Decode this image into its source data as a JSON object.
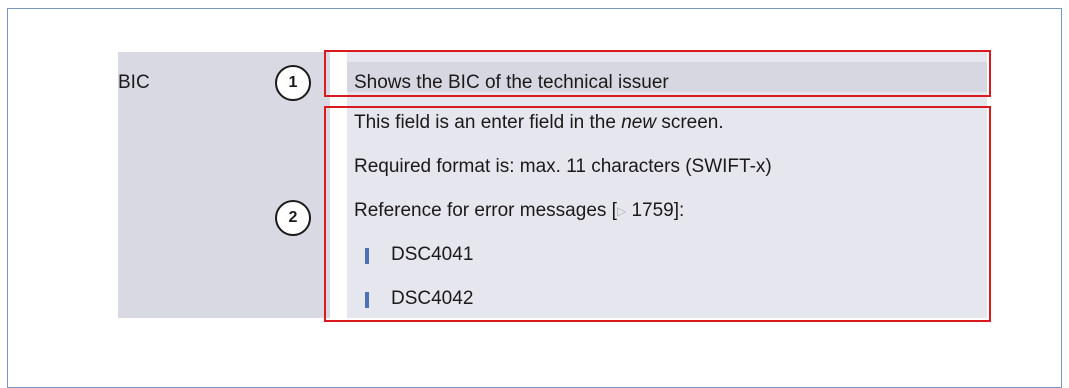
{
  "field": {
    "label": "BIC"
  },
  "description": {
    "summary": "Shows the BIC of the technical issuer",
    "enter_field_before": "This field is an enter field in the ",
    "enter_field_emphasis": "new",
    "enter_field_after": " screen.",
    "format": "Required format is: max. 11 characters (SWIFT-x)",
    "reference_before": "Reference for error messages [",
    "reference_page": "1759",
    "reference_after": "]:",
    "error_codes": [
      "DSC4041",
      "DSC4042"
    ]
  },
  "callouts": [
    "1",
    "2"
  ],
  "colors": {
    "highlight_border": "#d81a20",
    "bullet": "#4d6fb3",
    "frame_border": "#7a96c4"
  },
  "icons": {
    "reference_link": "right-triangle-icon",
    "list_bullet": "bar-bullet-icon"
  }
}
